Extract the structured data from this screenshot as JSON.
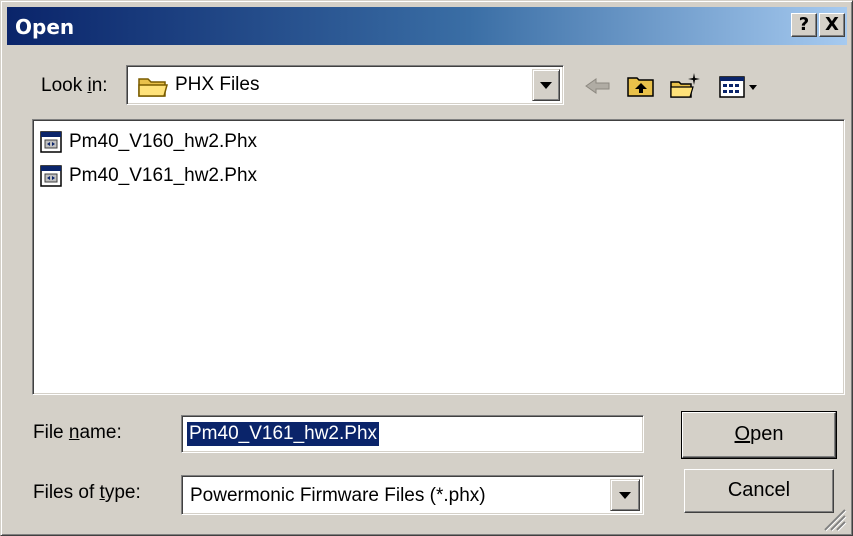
{
  "window": {
    "title": "Open",
    "help_label": "?",
    "close_label": "X"
  },
  "lookin": {
    "label_prefix": "Look ",
    "label_mnemonic": "i",
    "label_suffix": "n:",
    "value": "PHX Files",
    "icon": "folder-icon"
  },
  "toolbar": {
    "back_icon": "back-arrow-icon",
    "up_icon": "up-one-level-icon",
    "new_folder_icon": "new-folder-icon",
    "view_icon": "view-menu-icon"
  },
  "files": [
    {
      "name": "Pm40_V160_hw2.Phx",
      "icon": "phx-file-icon"
    },
    {
      "name": "Pm40_V161_hw2.Phx",
      "icon": "phx-file-icon"
    }
  ],
  "filename": {
    "label_prefix": "File ",
    "label_mnemonic": "n",
    "label_suffix": "ame:",
    "value": "Pm40_V161_hw2.Phx"
  },
  "filetype": {
    "label_prefix": "Files of ",
    "label_mnemonic": "t",
    "label_suffix": "ype:",
    "value": "Powermonic Firmware Files (*.phx)"
  },
  "buttons": {
    "open_mnemonic": "O",
    "open_rest": "pen",
    "cancel_label": "Cancel"
  },
  "colors": {
    "title_start": "#0a246a",
    "title_end": "#a6caf0",
    "face": "#d4d0c8",
    "selection": "#0a246a"
  }
}
